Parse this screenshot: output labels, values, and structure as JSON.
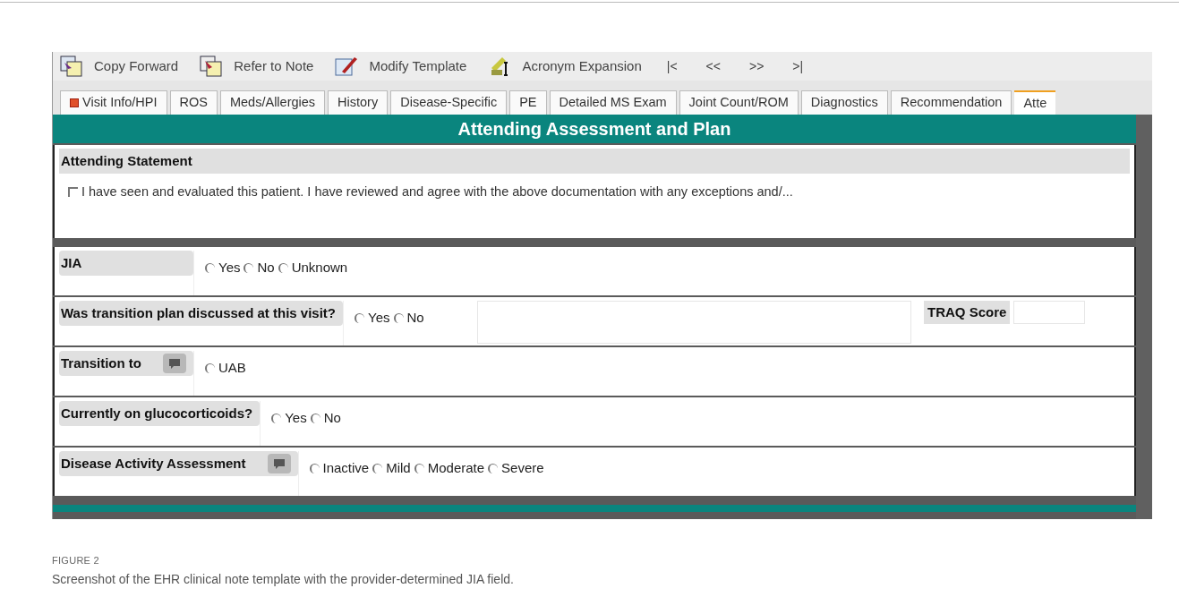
{
  "toolbar": {
    "buttons": [
      {
        "label": "Copy Forward",
        "kind": "copy"
      },
      {
        "label": "Refer to Note",
        "kind": "refer"
      },
      {
        "label": "Modify Template",
        "kind": "modify"
      },
      {
        "label": "Acronym Expansion",
        "kind": "acronym"
      }
    ],
    "nav": [
      "|<",
      "<<",
      ">>",
      ">|"
    ]
  },
  "tabs": [
    {
      "label": "Visit Info/HPI",
      "selected": false,
      "flagged": true
    },
    {
      "label": "ROS",
      "selected": false,
      "flagged": false
    },
    {
      "label": "Meds/Allergies",
      "selected": false,
      "flagged": false
    },
    {
      "label": "History",
      "selected": false,
      "flagged": false
    },
    {
      "label": "Disease-Specific",
      "selected": false,
      "flagged": false
    },
    {
      "label": "PE",
      "selected": false,
      "flagged": false
    },
    {
      "label": "Detailed MS Exam",
      "selected": false,
      "flagged": false
    },
    {
      "label": "Joint Count/ROM",
      "selected": false,
      "flagged": false
    },
    {
      "label": "Diagnostics",
      "selected": false,
      "flagged": false
    },
    {
      "label": "Recommendation",
      "selected": false,
      "flagged": false
    },
    {
      "label": "Atte",
      "selected": true,
      "flagged": false
    }
  ],
  "section_title": "Attending Assessment and Plan",
  "statement": {
    "heading": "Attending Statement",
    "checkbox": {
      "label": "I have seen and evaluated this patient. I have reviewed and agree with the above documentation with any exceptions and/...",
      "checked": false
    }
  },
  "fields": [
    {
      "label": "JIA",
      "comment": false,
      "options": [
        {
          "label": "Yes",
          "selected": false
        },
        {
          "label": "No",
          "selected": false
        },
        {
          "label": "Unknown",
          "selected": false
        }
      ]
    },
    {
      "label": "Was transition plan discussed at this visit?",
      "comment": false,
      "notes": true,
      "score": {
        "label": "TRAQ Score"
      },
      "options": [
        {
          "label": "Yes",
          "selected": false
        },
        {
          "label": "No",
          "selected": false
        }
      ]
    },
    {
      "label": "Transition to",
      "comment": true,
      "options": [
        {
          "label": "UAB",
          "selected": false
        }
      ]
    },
    {
      "label": "Currently on glucocorticoids?",
      "comment": false,
      "options": [
        {
          "label": "Yes",
          "selected": false
        },
        {
          "label": "No",
          "selected": false
        }
      ]
    },
    {
      "label": "Disease Activity Assessment",
      "comment": true,
      "options": [
        {
          "label": "Inactive",
          "selected": false
        },
        {
          "label": "Mild",
          "selected": false
        },
        {
          "label": "Moderate",
          "selected": false
        },
        {
          "label": "Severe",
          "selected": false
        }
      ]
    }
  ],
  "caption": {
    "label": "FIGURE 2",
    "text": "Screenshot of the EHR clinical note template with the provider-determined JIA field."
  }
}
